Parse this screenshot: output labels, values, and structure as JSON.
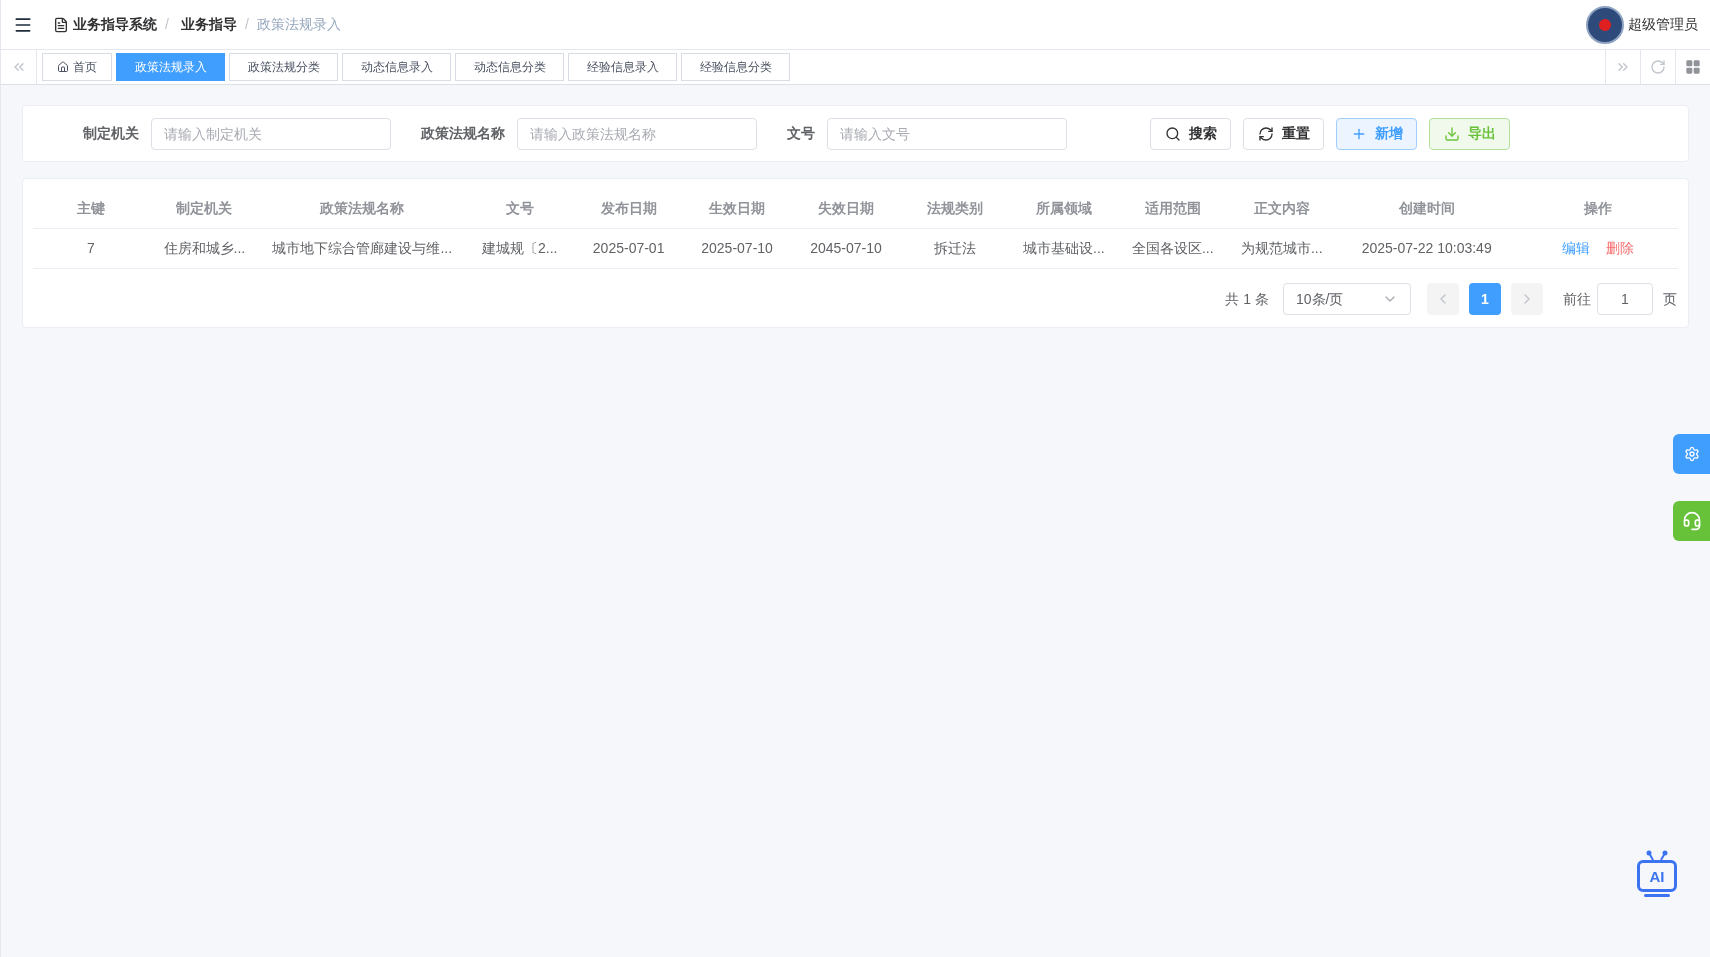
{
  "breadcrumb": [
    {
      "label": "业务指导系统",
      "current": false
    },
    {
      "label": "业务指导",
      "current": false
    },
    {
      "label": "政策法规录入",
      "current": true
    }
  ],
  "breadcrumb_separator": "/",
  "user": {
    "name": "超级管理员"
  },
  "tabs": [
    {
      "label": "首页",
      "selected": false,
      "kind": "home"
    },
    {
      "label": "政策法规录入",
      "selected": true,
      "kind": "page"
    },
    {
      "label": "政策法规分类",
      "selected": false,
      "kind": "page"
    },
    {
      "label": "动态信息录入",
      "selected": false,
      "kind": "page"
    },
    {
      "label": "动态信息分类",
      "selected": false,
      "kind": "page"
    },
    {
      "label": "经验信息录入",
      "selected": false,
      "kind": "page"
    },
    {
      "label": "经验信息分类",
      "selected": false,
      "kind": "page"
    }
  ],
  "filters": [
    {
      "label": "制定机关",
      "placeholder": "请输入制定机关"
    },
    {
      "label": "政策法规名称",
      "placeholder": "请输入政策法规名称"
    },
    {
      "label": "文号",
      "placeholder": "请输入文号"
    }
  ],
  "buttons": [
    {
      "label": "搜索",
      "kind": "search"
    },
    {
      "label": "重置",
      "kind": "reset"
    },
    {
      "label": "新增",
      "kind": "add"
    },
    {
      "label": "导出",
      "kind": "export"
    }
  ],
  "table": {
    "columns": [
      "主键",
      "制定机关",
      "政策法规名称",
      "文号",
      "发布日期",
      "生效日期",
      "失效日期",
      "法规类别",
      "所属领域",
      "适用范围",
      "正文内容",
      "创建时间",
      "操作"
    ],
    "rows": [
      {
        "cells": [
          "7",
          "住房和城乡...",
          "城市地下综合管廊建设与维...",
          "建城规〔2...",
          "2025-07-01",
          "2025-07-10",
          "2045-07-10",
          "拆迁法",
          "城市基础设...",
          "全国各设区...",
          "为规范城市...",
          "2025-07-22 10:03:49"
        ],
        "actions": [
          {
            "label": "编辑",
            "kind": "edit"
          },
          {
            "label": "删除",
            "kind": "delete"
          }
        ]
      }
    ]
  },
  "pagination": {
    "total": "共 1 条",
    "page_size": "10条/页",
    "pages": [
      {
        "label": "1",
        "selected": true
      }
    ],
    "goto_label": "前往",
    "goto_value": "1",
    "goto_suffix": "页"
  },
  "ai_assistant": {
    "label": "AI"
  }
}
